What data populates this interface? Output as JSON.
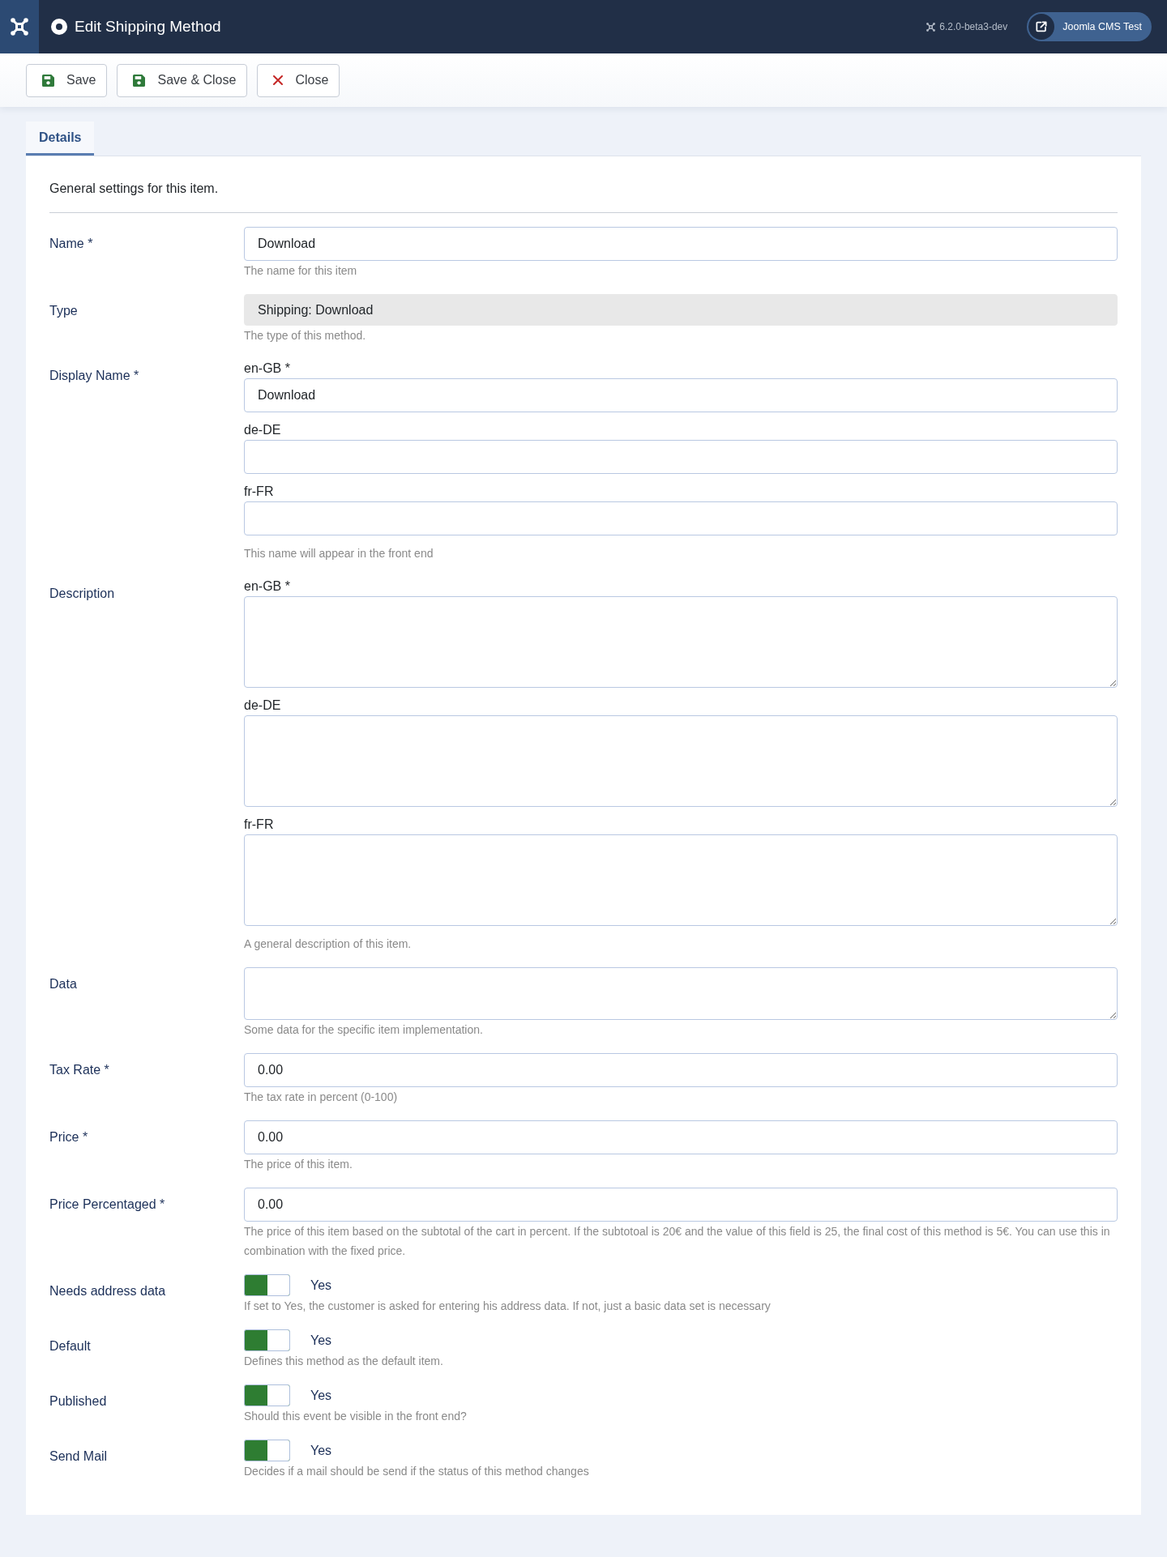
{
  "header": {
    "title": "Edit Shipping Method",
    "version": "6.2.0-beta3-dev",
    "site_link": "Joomla CMS Test"
  },
  "toolbar": [
    {
      "kind": "save",
      "label": "Save"
    },
    {
      "kind": "save",
      "label": "Save & Close"
    },
    {
      "kind": "close",
      "label": "Close"
    }
  ],
  "tabs": [
    {
      "label": "Details",
      "selected": true
    }
  ],
  "intro": "General settings for this item.",
  "fields": [
    {
      "kind": "text",
      "label": "Name *",
      "value": "Download",
      "hint": "The name for this item"
    },
    {
      "kind": "readonly",
      "label": "Type",
      "value": "Shipping: Download",
      "hint": "The type of this method."
    },
    {
      "kind": "translated",
      "multiline": false,
      "label": "Display Name *",
      "languages": [
        {
          "code": "en-GB *",
          "value": "Download"
        },
        {
          "code": "de-DE"
        },
        {
          "code": "fr-FR"
        }
      ],
      "hint": "This name will appear in the front end"
    },
    {
      "kind": "translated",
      "multiline": true,
      "label": "Description",
      "languages": [
        {
          "code": "en-GB *"
        },
        {
          "code": "de-DE"
        },
        {
          "code": "fr-FR"
        }
      ],
      "hint": "A general description of this item."
    },
    {
      "kind": "textarea",
      "label": "Data",
      "hint": "Some data for the specific item implementation."
    },
    {
      "kind": "text",
      "label": "Tax Rate *",
      "value": "0.00",
      "hint": "The tax rate in percent (0-100)"
    },
    {
      "kind": "text",
      "label": "Price *",
      "value": "0.00",
      "hint": "The price of this item."
    },
    {
      "kind": "text",
      "label": "Price Percentaged *",
      "value": "0.00",
      "hint": "The price of this item based on the subtotal of the cart in percent. If the subtotoal is 20€ and the value of this field is 25, the final cost of this method is 5€. You can use this in combination with the fixed price."
    },
    {
      "kind": "switch",
      "label": "Needs address data",
      "on": true,
      "state_label": "Yes",
      "hint": "If set to Yes, the customer is asked for entering his address data. If not, just a basic data set is necessary"
    },
    {
      "kind": "switch",
      "label": "Default",
      "on": true,
      "state_label": "Yes",
      "hint": "Defines this method as the default item."
    },
    {
      "kind": "switch",
      "label": "Published",
      "on": true,
      "state_label": "Yes",
      "hint": "Should this event be visible in the front end?"
    },
    {
      "kind": "switch",
      "label": "Send Mail",
      "on": true,
      "state_label": "Yes",
      "hint": "Decides if a mail should be send if the status of this method changes"
    }
  ]
}
